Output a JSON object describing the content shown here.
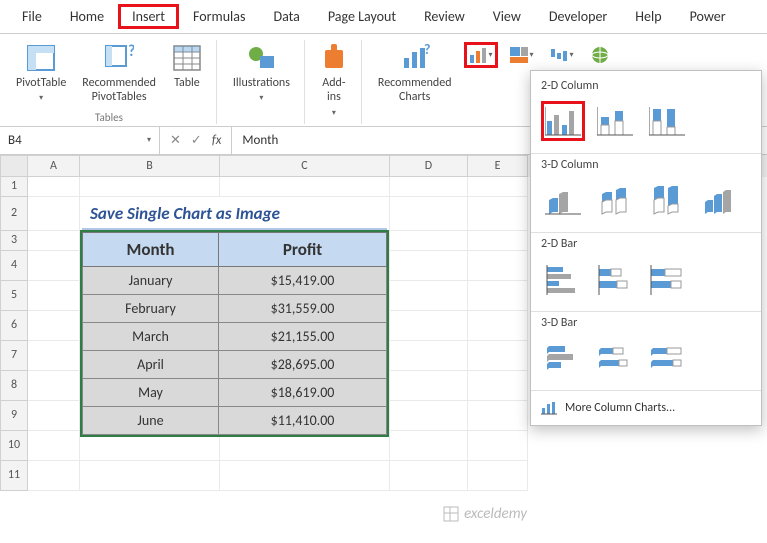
{
  "menu": {
    "file": "File",
    "home": "Home",
    "insert": "Insert",
    "formulas": "Formulas",
    "data": "Data",
    "page_layout": "Page Layout",
    "review": "Review",
    "view": "View",
    "developer": "Developer",
    "help": "Help",
    "power": "Power"
  },
  "ribbon": {
    "pivottable": "PivotTable",
    "recommended_pivot": "Recommended\nPivotTables",
    "table": "Table",
    "illustrations": "Illustrations",
    "addins": "Add-\nins",
    "recommended_charts": "Recommended\nCharts",
    "tables_group": "Tables"
  },
  "namebox": "B4",
  "formula": "Month",
  "cols": {
    "A": "A",
    "B": "B",
    "C": "C",
    "D": "D",
    "E": "E"
  },
  "rownums": [
    "1",
    "2",
    "3",
    "4",
    "5",
    "6",
    "7",
    "8",
    "9",
    "10",
    "11"
  ],
  "title": "Save Single Chart as Image",
  "table": {
    "h1": "Month",
    "h2": "Profit",
    "rows": [
      {
        "m": "January",
        "p": "$15,419.00"
      },
      {
        "m": "February",
        "p": "$31,559.00"
      },
      {
        "m": "March",
        "p": "$21,155.00"
      },
      {
        "m": "April",
        "p": "$28,695.00"
      },
      {
        "m": "May",
        "p": "$18,619.00"
      },
      {
        "m": "June",
        "p": "$11,410.00"
      }
    ]
  },
  "gallery": {
    "s1": "2-D Column",
    "s2": "3-D Column",
    "s3": "2-D Bar",
    "s4": "3-D Bar",
    "more": "More Column Charts..."
  },
  "watermark": "exceldemy"
}
